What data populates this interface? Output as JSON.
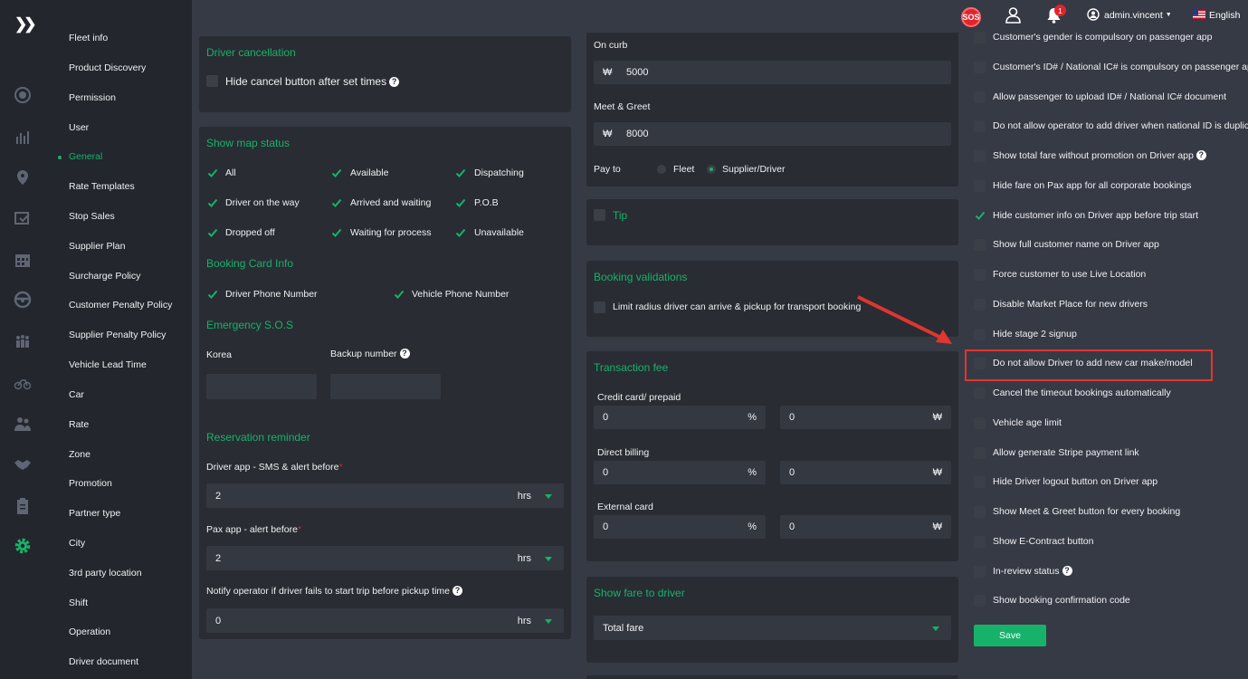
{
  "sidebar": {
    "expand_icon": "double-chevron-right-icon",
    "rail_icons": [
      "plus-circle-icon",
      "chart-icon",
      "location-pin-icon",
      "checklist-icon",
      "calendar-icon",
      "steering-wheel-icon",
      "group-icon",
      "bike-icon",
      "users-icon",
      "handshake-icon",
      "clipboard-icon",
      "gear-icon"
    ],
    "menu": [
      "Fleet info",
      "Product Discovery",
      "Permission",
      "User",
      "General",
      "Rate Templates",
      "Stop Sales",
      "Supplier Plan",
      "Surcharge Policy",
      "Customer Penalty Policy",
      "Supplier Penalty Policy",
      "Vehicle Lead Time",
      "Car",
      "Rate",
      "Zone",
      "Promotion",
      "Partner type",
      "City",
      "3rd party location",
      "Shift",
      "Operation",
      "Driver document"
    ],
    "active": "General"
  },
  "topbar": {
    "sos": "SOS",
    "notification_count": "1",
    "user": "admin.vincent",
    "language": "English"
  },
  "col1": {
    "driver_cancellation": {
      "title": "Driver cancellation",
      "hide_cancel": "Hide cancel button after set times"
    },
    "map_status": {
      "title": "Show map status",
      "items": [
        "All",
        "Available",
        "Dispatching",
        "Driver on the way",
        "Arrived and waiting",
        "P.O.B",
        "Dropped off",
        "Waiting for process",
        "Unavailable"
      ]
    },
    "booking_card": {
      "title": "Booking Card Info",
      "items": [
        "Driver Phone Number",
        "Vehicle Phone Number"
      ]
    },
    "emergency": {
      "title": "Emergency S.O.S",
      "korea": "Korea",
      "backup": "Backup number"
    },
    "reminder": {
      "title": "Reservation reminder",
      "driver_label": "Driver app - SMS & alert before",
      "driver_value": "2",
      "pax_label": "Pax app - alert before",
      "pax_value": "2",
      "notify_label": "Notify operator if driver fails to start trip before pickup time",
      "notify_value": "0",
      "unit": "hrs"
    }
  },
  "col2": {
    "on_curb": {
      "label": "On curb",
      "currency": "₩",
      "value": "5000"
    },
    "meet_greet": {
      "label": "Meet & Greet",
      "currency": "₩",
      "value": "8000"
    },
    "pay_to": {
      "label": "Pay to",
      "options": [
        "Fleet",
        "Supplier/Driver"
      ],
      "selected": "Supplier/Driver"
    },
    "tip": {
      "title": "Tip"
    },
    "validations": {
      "title": "Booking validations",
      "limit_radius": "Limit radius driver can arrive & pickup for transport booking"
    },
    "transaction": {
      "title": "Transaction fee",
      "rows": [
        {
          "label": "Credit card/ prepaid",
          "percent": "0",
          "amount": "0"
        },
        {
          "label": "Direct billing",
          "percent": "0",
          "amount": "0"
        },
        {
          "label": "External card",
          "percent": "0",
          "amount": "0"
        }
      ],
      "percent_unit": "%",
      "currency": "₩"
    },
    "show_fare": {
      "title": "Show fare to driver",
      "value": "Total fare"
    }
  },
  "col3": {
    "options": [
      {
        "label": "Customer's gender is compulsory on passenger app",
        "checked": false
      },
      {
        "label": "Customer's ID# / National IC# is compulsory on passenger app",
        "checked": false
      },
      {
        "label": "Allow passenger to upload ID# / National IC# document",
        "checked": false
      },
      {
        "label": "Do not allow operator to add driver when national ID is duplicated",
        "checked": false
      },
      {
        "label": "Show total fare without promotion on Driver app",
        "checked": false,
        "help": true
      },
      {
        "label": "Hide fare on Pax app for all corporate bookings",
        "checked": false
      },
      {
        "label": "Hide customer info on Driver app before trip start",
        "checked": true
      },
      {
        "label": "Show full customer name on Driver app",
        "checked": false
      },
      {
        "label": "Force customer to use Live Location",
        "checked": false
      },
      {
        "label": "Disable Market Place for new drivers",
        "checked": false
      },
      {
        "label": "Hide stage 2 signup",
        "checked": false
      },
      {
        "label": "Do not allow Driver to add new car make/model",
        "checked": false
      },
      {
        "label": "Cancel the timeout bookings automatically",
        "checked": false
      },
      {
        "label": "Vehicle age limit",
        "checked": false
      },
      {
        "label": "Allow generate Stripe payment link",
        "checked": false
      },
      {
        "label": "Hide Driver logout button on Driver app",
        "checked": false
      },
      {
        "label": "Show Meet & Greet button for every booking",
        "checked": false
      },
      {
        "label": "Show E-Contract button",
        "checked": false
      },
      {
        "label": "In-review status",
        "checked": false,
        "help": true
      },
      {
        "label": "Show booking confirmation code",
        "checked": false
      }
    ],
    "save": "Save"
  },
  "colors": {
    "accent": "#17b26a",
    "annotation": "#e13530",
    "background": "#363a45",
    "panel": "#292c33"
  }
}
